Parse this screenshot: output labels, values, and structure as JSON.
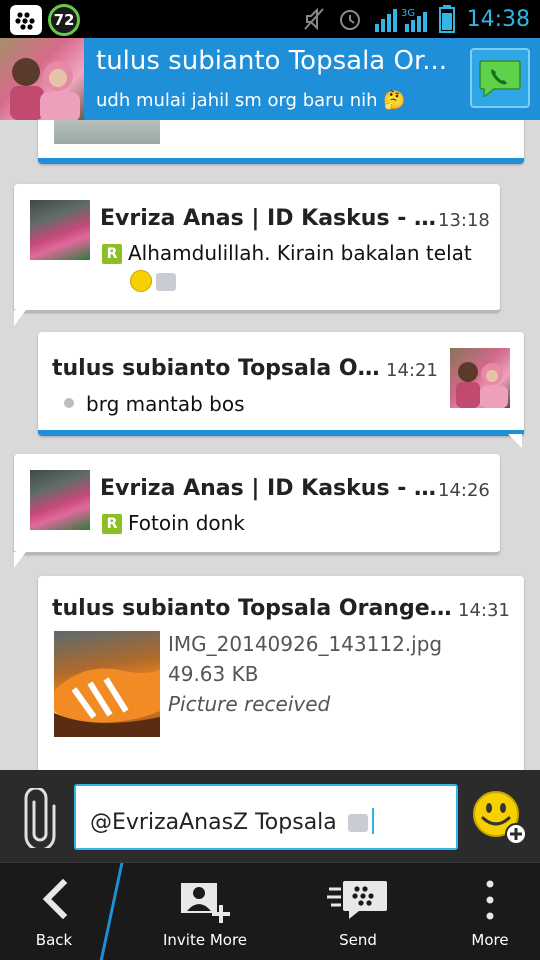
{
  "status_bar": {
    "battery_badge": "72",
    "time": "14:38",
    "network": "3G"
  },
  "header": {
    "contact_name": "tulus subianto Topsala Or...",
    "status_message": "udh mulai jahil sm org baru nih 🤔",
    "call_icon": "phone-icon"
  },
  "messages": [
    {
      "direction": "received",
      "sender": "Evriza Anas | ID Kaskus - ev...",
      "time": "13:18",
      "text": "Alhamdulillah. Kirain bakalan telat",
      "read_marker": "R",
      "emoticons": [
        "smiley",
        "thumbs-up"
      ]
    },
    {
      "direction": "sent",
      "sender": "tulus subianto Topsala Ora...",
      "time": "14:21",
      "text": "brg mantab bos"
    },
    {
      "direction": "received",
      "sender": "Evriza Anas | ID Kaskus - ev...",
      "time": "14:26",
      "text": "Fotoin donk",
      "read_marker": "R"
    },
    {
      "direction": "sent",
      "sender": "tulus subianto Topsala Orange (44)",
      "time": "14:31",
      "attachment": {
        "file_name": "IMG_20140926_143112.jpg",
        "file_size": "49.63 KB",
        "status": "Picture received"
      }
    }
  ],
  "composer": {
    "input_value": "@EvrizaAnasZ Topsala"
  },
  "bottom_bar": {
    "back_label": "Back",
    "invite_label": "Invite More",
    "send_label": "Send",
    "more_label": "More"
  },
  "colors": {
    "accent": "#1e8fd8",
    "status_text": "#33b5e5",
    "read_marker": "#8cbf26"
  }
}
